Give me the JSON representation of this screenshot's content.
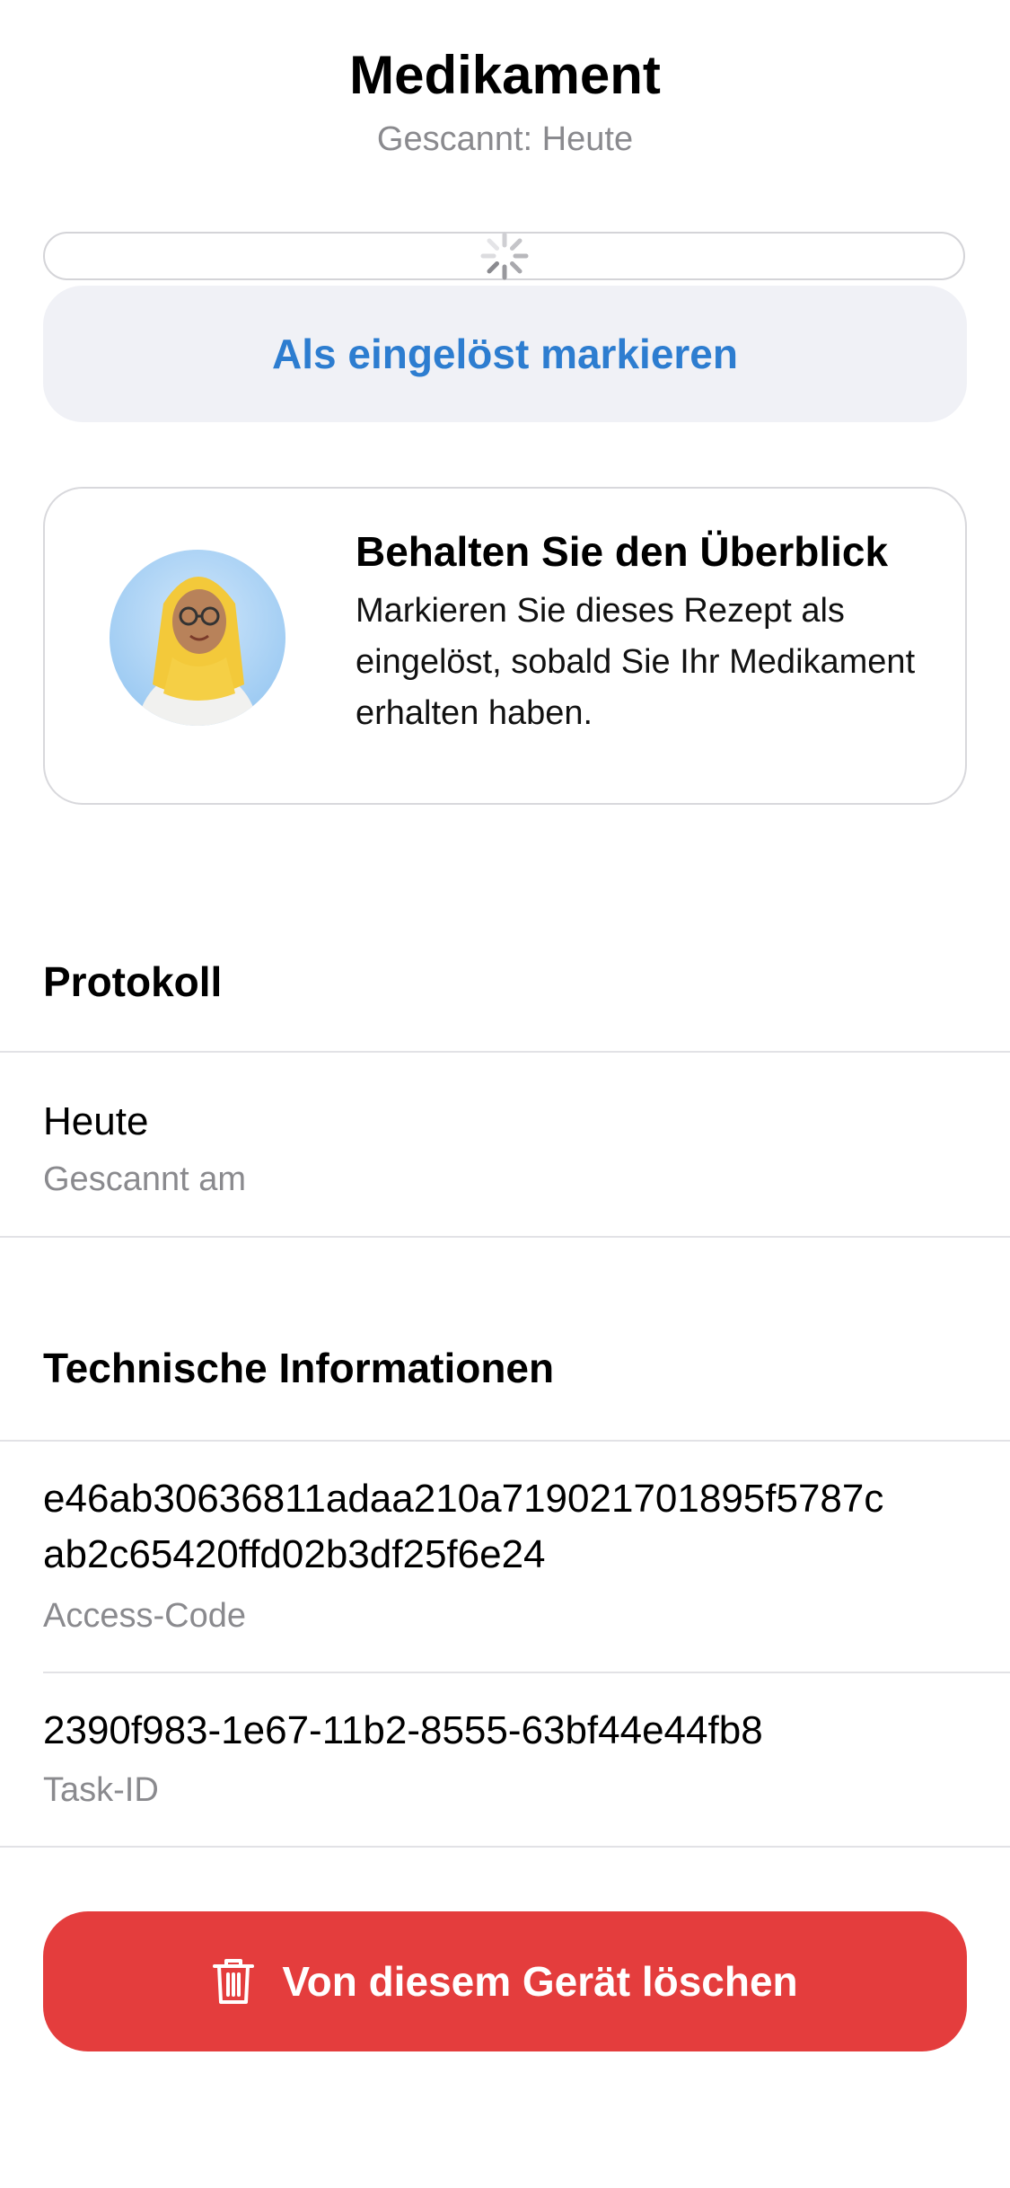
{
  "header": {
    "title": "Medikament",
    "subtitle": "Gescannt: Heute"
  },
  "actions": {
    "mark_redeemed": "Als eingelöst markieren",
    "delete": "Von diesem Gerät löschen"
  },
  "hint": {
    "title": "Behalten Sie den Überblick",
    "body": "Markieren Sie dieses Rezept als eingelöst, sobald Sie Ihr Medikament erhalten haben."
  },
  "protocol": {
    "section_title": "Protokoll",
    "entries": [
      {
        "value": "Heute",
        "label": "Gescannt am"
      }
    ]
  },
  "technical": {
    "section_title": "Technische Informationen",
    "access_code": {
      "value": "e46ab30636811adaa210a719021701895f5787cab2c65420ffd02b3df25f6e24",
      "line1": "e46ab30636811adaa210a719021701895f5787c",
      "line2": "ab2c65420ffd02b3df25f6e24",
      "label": "Access-Code"
    },
    "task_id": {
      "value": "2390f983-1e67-11b2-8555-63bf44e44fb8",
      "label": "Task-ID"
    }
  },
  "icons": {
    "loading": "loading-spinner-icon",
    "trash": "trash-icon",
    "avatar": "pharmacist-avatar"
  },
  "colors": {
    "accent": "#2d7dd0",
    "danger": "#e43d3d",
    "secondary_text": "#8a8a8e",
    "button_bg": "#f0f1f6"
  }
}
